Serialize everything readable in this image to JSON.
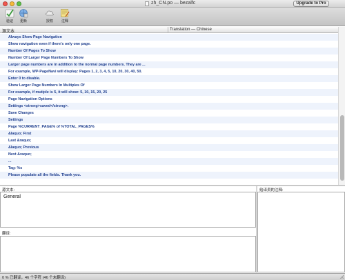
{
  "window": {
    "title": "zh_CN.po — bezalfc",
    "upgrade_label": "Upgrade to Pro"
  },
  "toolbar": {
    "items": [
      {
        "label": "验证",
        "icon": "checkmark-icon"
      },
      {
        "label": "更新",
        "icon": "globe-update-icon"
      },
      {
        "label": "授权",
        "icon": "cloud-icon"
      },
      {
        "label": "注释",
        "icon": "note-pencil-icon"
      }
    ]
  },
  "list": {
    "column_source": "源文本",
    "column_translation": "Translation — Chinese",
    "rows": [
      "Always Show Page Navigation",
      "Show navigation even if there's only one page.",
      "Number Of Pages To Show",
      "Number Of Larger Page Numbers To Show",
      "Larger page numbers are in addition to the normal page numbers. They are ...",
      "For example, WP-PageNavi will display: Pages 1, 2, 3, 4, 5, 10, 20, 30, 40, 50.",
      "Enter 0 to disable.",
      "Show Larger Page Numbers In Multiples Of",
      "For example, if mutiple is 5, it will show: 5, 10, 15, 20, 25",
      "Page Navigation Options",
      "Settings <strong>saved</strong>.",
      "Save Changes",
      "Settings",
      "Page %CURRENT_PAGE% of %TOTAL_PAGES%",
      "&laquo; First",
      "Last &raquo;",
      "&laquo; Previous",
      "Next &raquo;",
      "...",
      "Tag: %s",
      "Please populate all the fields. Thank you."
    ]
  },
  "editor": {
    "source_label": "源文本:",
    "source_text": "General",
    "translation_label": "翻译:",
    "translation_text": "",
    "comments_label": "给译员的注释:"
  },
  "status": {
    "text": "0 % 已翻译，46 个字符 (46 个未翻译)"
  },
  "colors": {
    "row_text": "#1f3f8f",
    "row_alt": "#eef3fc",
    "close": "#f2564d",
    "minimize": "#f6bb3a",
    "zoom": "#5dc246"
  }
}
